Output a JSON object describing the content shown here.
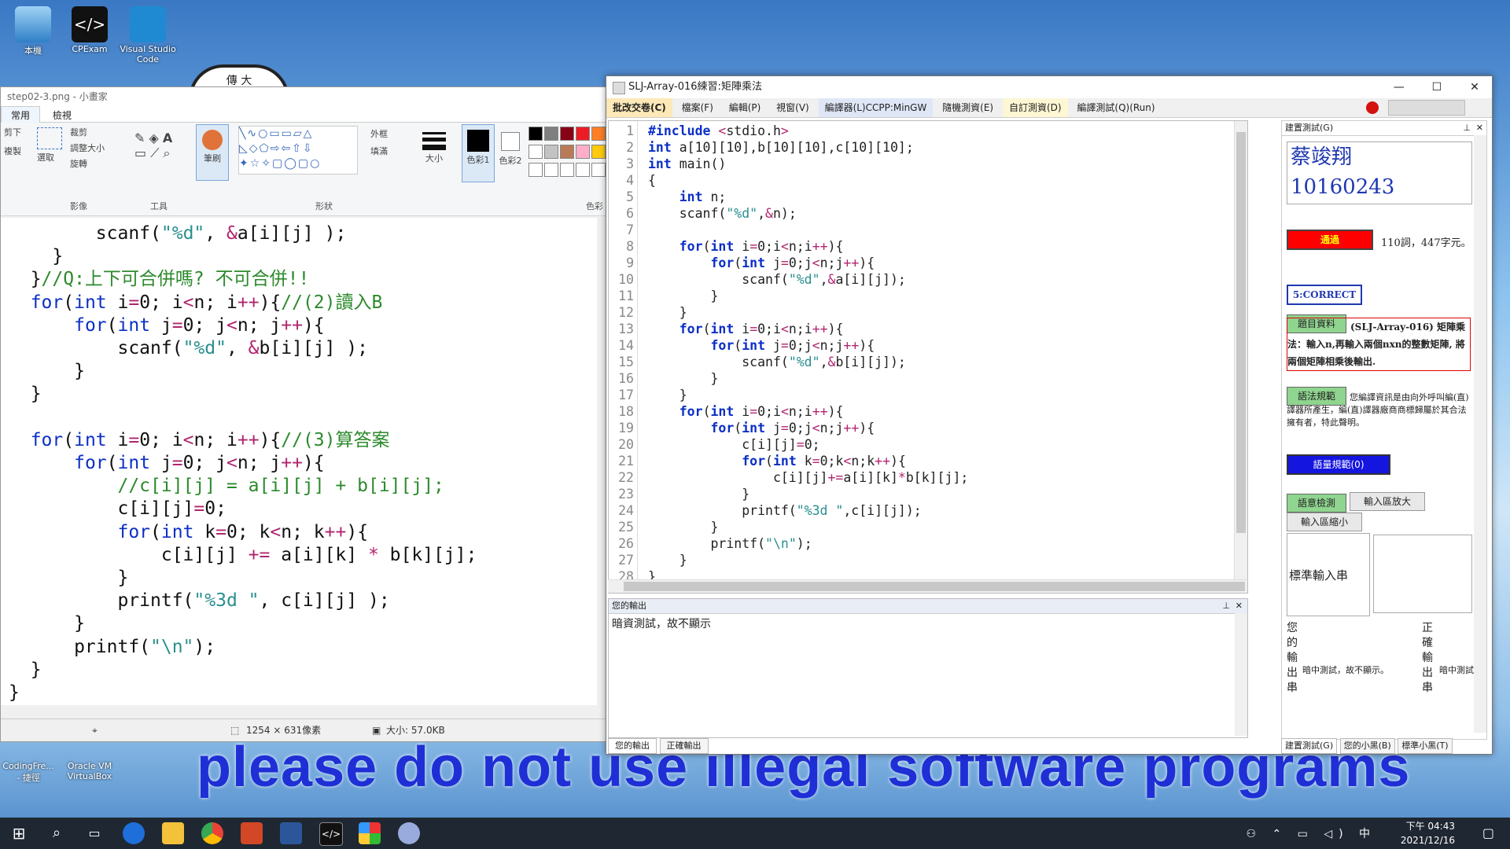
{
  "desktop": {
    "icons": [
      {
        "label": "本機"
      },
      {
        "label": "CPExam"
      },
      {
        "label": "Visual Studio Code"
      },
      {
        "label": "CodingFre... - 捷徑"
      },
      {
        "label": "Oracle VM VirtualBox"
      }
    ],
    "banner": "please do not use illegal software programs",
    "logo_char": "傳 大"
  },
  "paint": {
    "title": "step02-3.png - 小畫家",
    "tabs": [
      "常用",
      "檢視"
    ],
    "ribbon": {
      "clipboard": [
        "剪下",
        "複製"
      ],
      "image_group": "影像",
      "image_items": [
        "選取",
        "裁剪",
        "調整大小",
        "旋轉"
      ],
      "tools_group": "工具",
      "brush_label": "筆刷",
      "shapes_group": "形狀",
      "outline_label": "外框",
      "fill_label": "填滿",
      "size_label": "大小",
      "color1_label": "色彩1",
      "color2_label": "色彩2",
      "colors_group": "色彩"
    },
    "status": {
      "dimensions": "1254 × 631像素",
      "size": "大小: 57.0KB"
    },
    "code": [
      "        scanf(\"%d\", &a[i][j] );",
      "    }",
      "  }//Q:上下可合併嗎? 不可合併!!",
      "  for(int i=0; i<n; i++){//(2)讀入B",
      "      for(int j=0; j<n; j++){",
      "          scanf(\"%d\", &b[i][j] );",
      "      }",
      "  }",
      "",
      "  for(int i=0; i<n; i++){//(3)算答案",
      "      for(int j=0; j<n; j++){",
      "          //c[i][j] = a[i][j] + b[i][j];",
      "          c[i][j]=0;",
      "          for(int k=0; k<n; k++){",
      "              c[i][j] += a[i][k] * b[k][j];",
      "          }",
      "          printf(\"%3d \", c[i][j] );",
      "      }",
      "      printf(\"\\n\");",
      "  }",
      "}"
    ]
  },
  "judge": {
    "title": "SLJ-Array-016練習:矩陣乘法",
    "window_controls": [
      "—",
      "☐",
      "✕"
    ],
    "menu": [
      "批改交卷(C)",
      "檔案(F)",
      "編輯(P)",
      "視窗(V)",
      "編譯器(L)CCPP:MinGW",
      "隨機測資(E)",
      "自訂測資(D)",
      "編譯測試(Q)(Run)"
    ],
    "line_numbers": [
      "1",
      "2",
      "3",
      "4",
      "5",
      "6",
      "7",
      "8",
      "9",
      "10",
      "11",
      "12",
      "13",
      "14",
      "15",
      "16",
      "17",
      "18",
      "19",
      "20",
      "21",
      "22",
      "23",
      "24",
      "25",
      "26",
      "27",
      "28"
    ],
    "code": [
      "#include <stdio.h>",
      "int a[10][10],b[10][10],c[10][10];",
      "int main()",
      "{",
      "    int n;",
      "    scanf(\"%d\",&n);",
      "",
      "    for(int i=0;i<n;i++){",
      "        for(int j=0;j<n;j++){",
      "            scanf(\"%d\",&a[i][j]);",
      "        }",
      "    }",
      "    for(int i=0;i<n;i++){",
      "        for(int j=0;j<n;j++){",
      "            scanf(\"%d\",&b[i][j]);",
      "        }",
      "    }",
      "    for(int i=0;i<n;i++){",
      "        for(int j=0;j<n;j++){",
      "            c[i][j]=0;",
      "            for(int k=0;k<n;k++){",
      "                c[i][j]+=a[i][k]*b[k][j];",
      "            }",
      "            printf(\"%3d \",c[i][j]);",
      "        }",
      "        printf(\"\\n\");",
      "    }",
      "}"
    ],
    "output_panel": {
      "title": "您的輸出",
      "content": "暗資測試，故不顯示"
    },
    "bottom_tabs": [
      "您的輸出",
      "正確輸出"
    ],
    "right_panel": {
      "title": "建置測試(G)",
      "student_name": "蔡竣翔",
      "student_id": "10160243",
      "pass_button": "通過",
      "pass_stats": "110詞，447字元。",
      "result": "5:CORRECT",
      "problem_button": "題目資料",
      "problem_text": "(SLJ-Array-016) 矩陣乘法：輸入n,再輸入兩個nxn的整數矩陣, 將兩個矩陣相乘後輸出.",
      "syntax_button": "語法規範",
      "syntax_text": "您編譯資訊是由向外呼叫編(直)譯器所產生，編(直)譯器廠商商標歸屬於其合法擁有者，特此聲明。",
      "spec_button": "語量規範(0)",
      "check_button": "語意檢測",
      "enlarge_button": "輸入區放大",
      "shrink_button": "輸入區縮小",
      "std_input_label": "標準輸入串",
      "your_output_label": "您的輸出串",
      "your_output_text": "暗中測試，故不顯示。",
      "correct_output_label": "正確輸出串",
      "correct_output_text": "暗中測試",
      "tabs": [
        "建置測試(G)",
        "您的小黑(B)",
        "標準小黑(T)"
      ]
    }
  },
  "taskbar": {
    "time": "下午 04:43",
    "date": "2021/12/16"
  }
}
